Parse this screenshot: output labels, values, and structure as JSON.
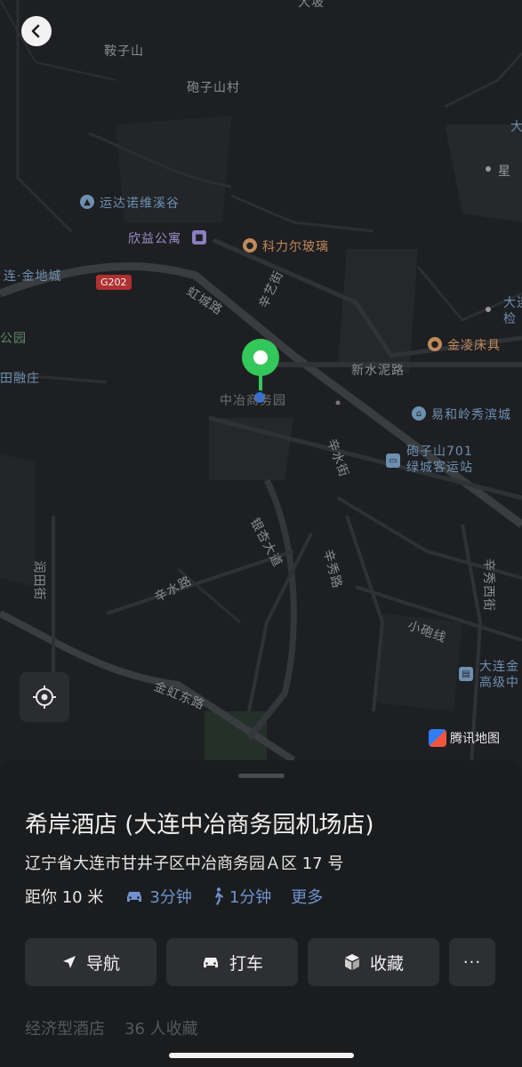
{
  "map": {
    "labels": {
      "anzishan": "鞍子山",
      "paozishancun": "砲子山村",
      "yunda": "运达诺维溪谷",
      "xinyi": "欣益公寓",
      "kelier": "科力尔玻璃",
      "liandijincheng": "连·金地城",
      "gongyuan": "公园",
      "rongzhuang": "田融庄",
      "hongchenglu": "虹城路",
      "xinyijie": "辛艺街",
      "xinshuinilu": "新水泥路",
      "jinling": "金凌床具",
      "yihelingxiu": "易和岭秀滨城",
      "paozishan701": "砲子山701",
      "lvcheng": "绿城客运站",
      "xinshuijie": "辛水街",
      "zhongye": "中冶商务园",
      "yinxing": "银杏大道",
      "xinxiulu": "辛秀路",
      "xinxiuxijie": "辛秀西街",
      "runtianjie": "润田街",
      "xinshuilu": "辛水路",
      "xiaopaoxian": "小砲线",
      "dalianjin": "大连金",
      "gaojizhong": "高级中",
      "jinhongdonglu": "金虹东路",
      "xingqin": "星",
      "dalianjian": "大连",
      "jian": "检",
      "dasuo": "大",
      "dabo": "大坡",
      "g202": "G202"
    },
    "provider": "腾讯地图"
  },
  "place": {
    "name": "希岸酒店 (大连中冶商务园机场店)",
    "address": "辽宁省大连市甘井子区中冶商务园Ａ区 17 号",
    "distance": "距你 10 米",
    "drive": "3分钟",
    "walk": "1分钟",
    "more": "更多"
  },
  "actions": {
    "navigate": "导航",
    "taxi": "打车",
    "favorite": "收藏",
    "more": "···"
  },
  "tags": {
    "type": "经济型酒店",
    "saves": "36 人收藏"
  },
  "colors": {
    "pin": "#34c759",
    "user_dot": "#2f6fe0",
    "link": "#6f93d0"
  }
}
